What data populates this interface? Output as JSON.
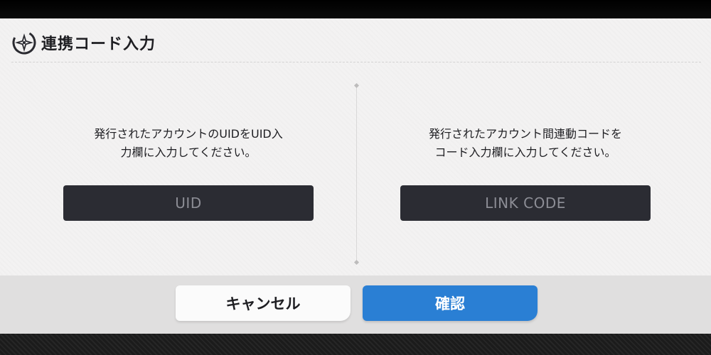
{
  "dialog": {
    "title": "連携コード入力",
    "icon": "compass-star-icon"
  },
  "uid_panel": {
    "instruction_line1": "発行されたアカウントのUIDをUID入",
    "instruction_line2": "力欄に入力してください。",
    "input_placeholder": "UID"
  },
  "link_panel": {
    "instruction_line1": "発行されたアカウント間連動コードを",
    "instruction_line2": "コード入力欄に入力してください。",
    "input_placeholder": "LINK CODE"
  },
  "footer": {
    "cancel_label": "キャンセル",
    "confirm_label": "確認"
  },
  "colors": {
    "confirm_button": "#2a7fd4",
    "input_background": "#2b2c33",
    "dialog_background": "#f3f2f2"
  }
}
